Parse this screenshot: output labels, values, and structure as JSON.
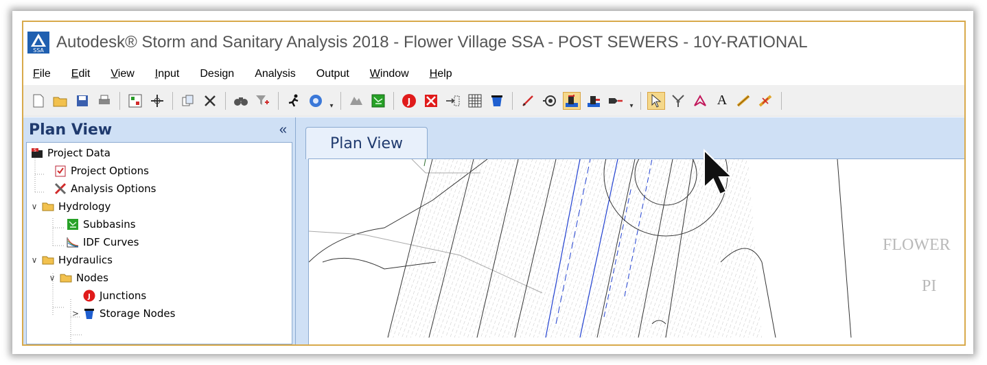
{
  "window": {
    "title": "Autodesk® Storm and Sanitary Analysis 2018 - Flower Village SSA - POST SEWERS - 10Y-RATIONAL",
    "logo_text": "SSA"
  },
  "menubar": {
    "items": [
      {
        "label": "File",
        "underline": "F",
        "rest": "ile"
      },
      {
        "label": "Edit",
        "underline": "E",
        "rest": "dit"
      },
      {
        "label": "View",
        "underline": "V",
        "rest": "iew"
      },
      {
        "label": "Input",
        "underline": "I",
        "rest": "nput"
      },
      {
        "label": "Design",
        "underline": "",
        "rest": "Design"
      },
      {
        "label": "Analysis",
        "underline": "",
        "rest": "Analysis"
      },
      {
        "label": "Output",
        "underline": "",
        "rest": "Output"
      },
      {
        "label": "Window",
        "underline": "W",
        "rest": "indow"
      },
      {
        "label": "Help",
        "underline": "H",
        "rest": "elp"
      }
    ]
  },
  "toolbar": {
    "active_tool": "add-inlet-button",
    "colors": {
      "red": "#e01b1b",
      "blue": "#1f5fd0",
      "highlight": "#f5d88a"
    }
  },
  "sidebar": {
    "title": "Plan View",
    "collapse_glyph": "«",
    "tree": [
      {
        "label": "Project Data",
        "icon": "project-data-icon"
      },
      {
        "label": "Project Options",
        "icon": "project-options-icon"
      },
      {
        "label": "Analysis Options",
        "icon": "analysis-options-icon"
      },
      {
        "label": "Hydrology",
        "icon": "folder-icon"
      },
      {
        "label": "Subbasins",
        "icon": "subbasins-icon"
      },
      {
        "label": "IDF Curves",
        "icon": "idf-curves-icon"
      },
      {
        "label": "Hydraulics",
        "icon": "folder-icon"
      },
      {
        "label": "Nodes",
        "icon": "folder-icon"
      },
      {
        "label": "Junctions",
        "icon": "junction-icon"
      },
      {
        "label": "Storage Nodes",
        "icon": "storage-node-icon"
      }
    ]
  },
  "main": {
    "tab_label": "Plan View",
    "canvas_labels": [
      "FLOWER",
      "PI"
    ]
  }
}
